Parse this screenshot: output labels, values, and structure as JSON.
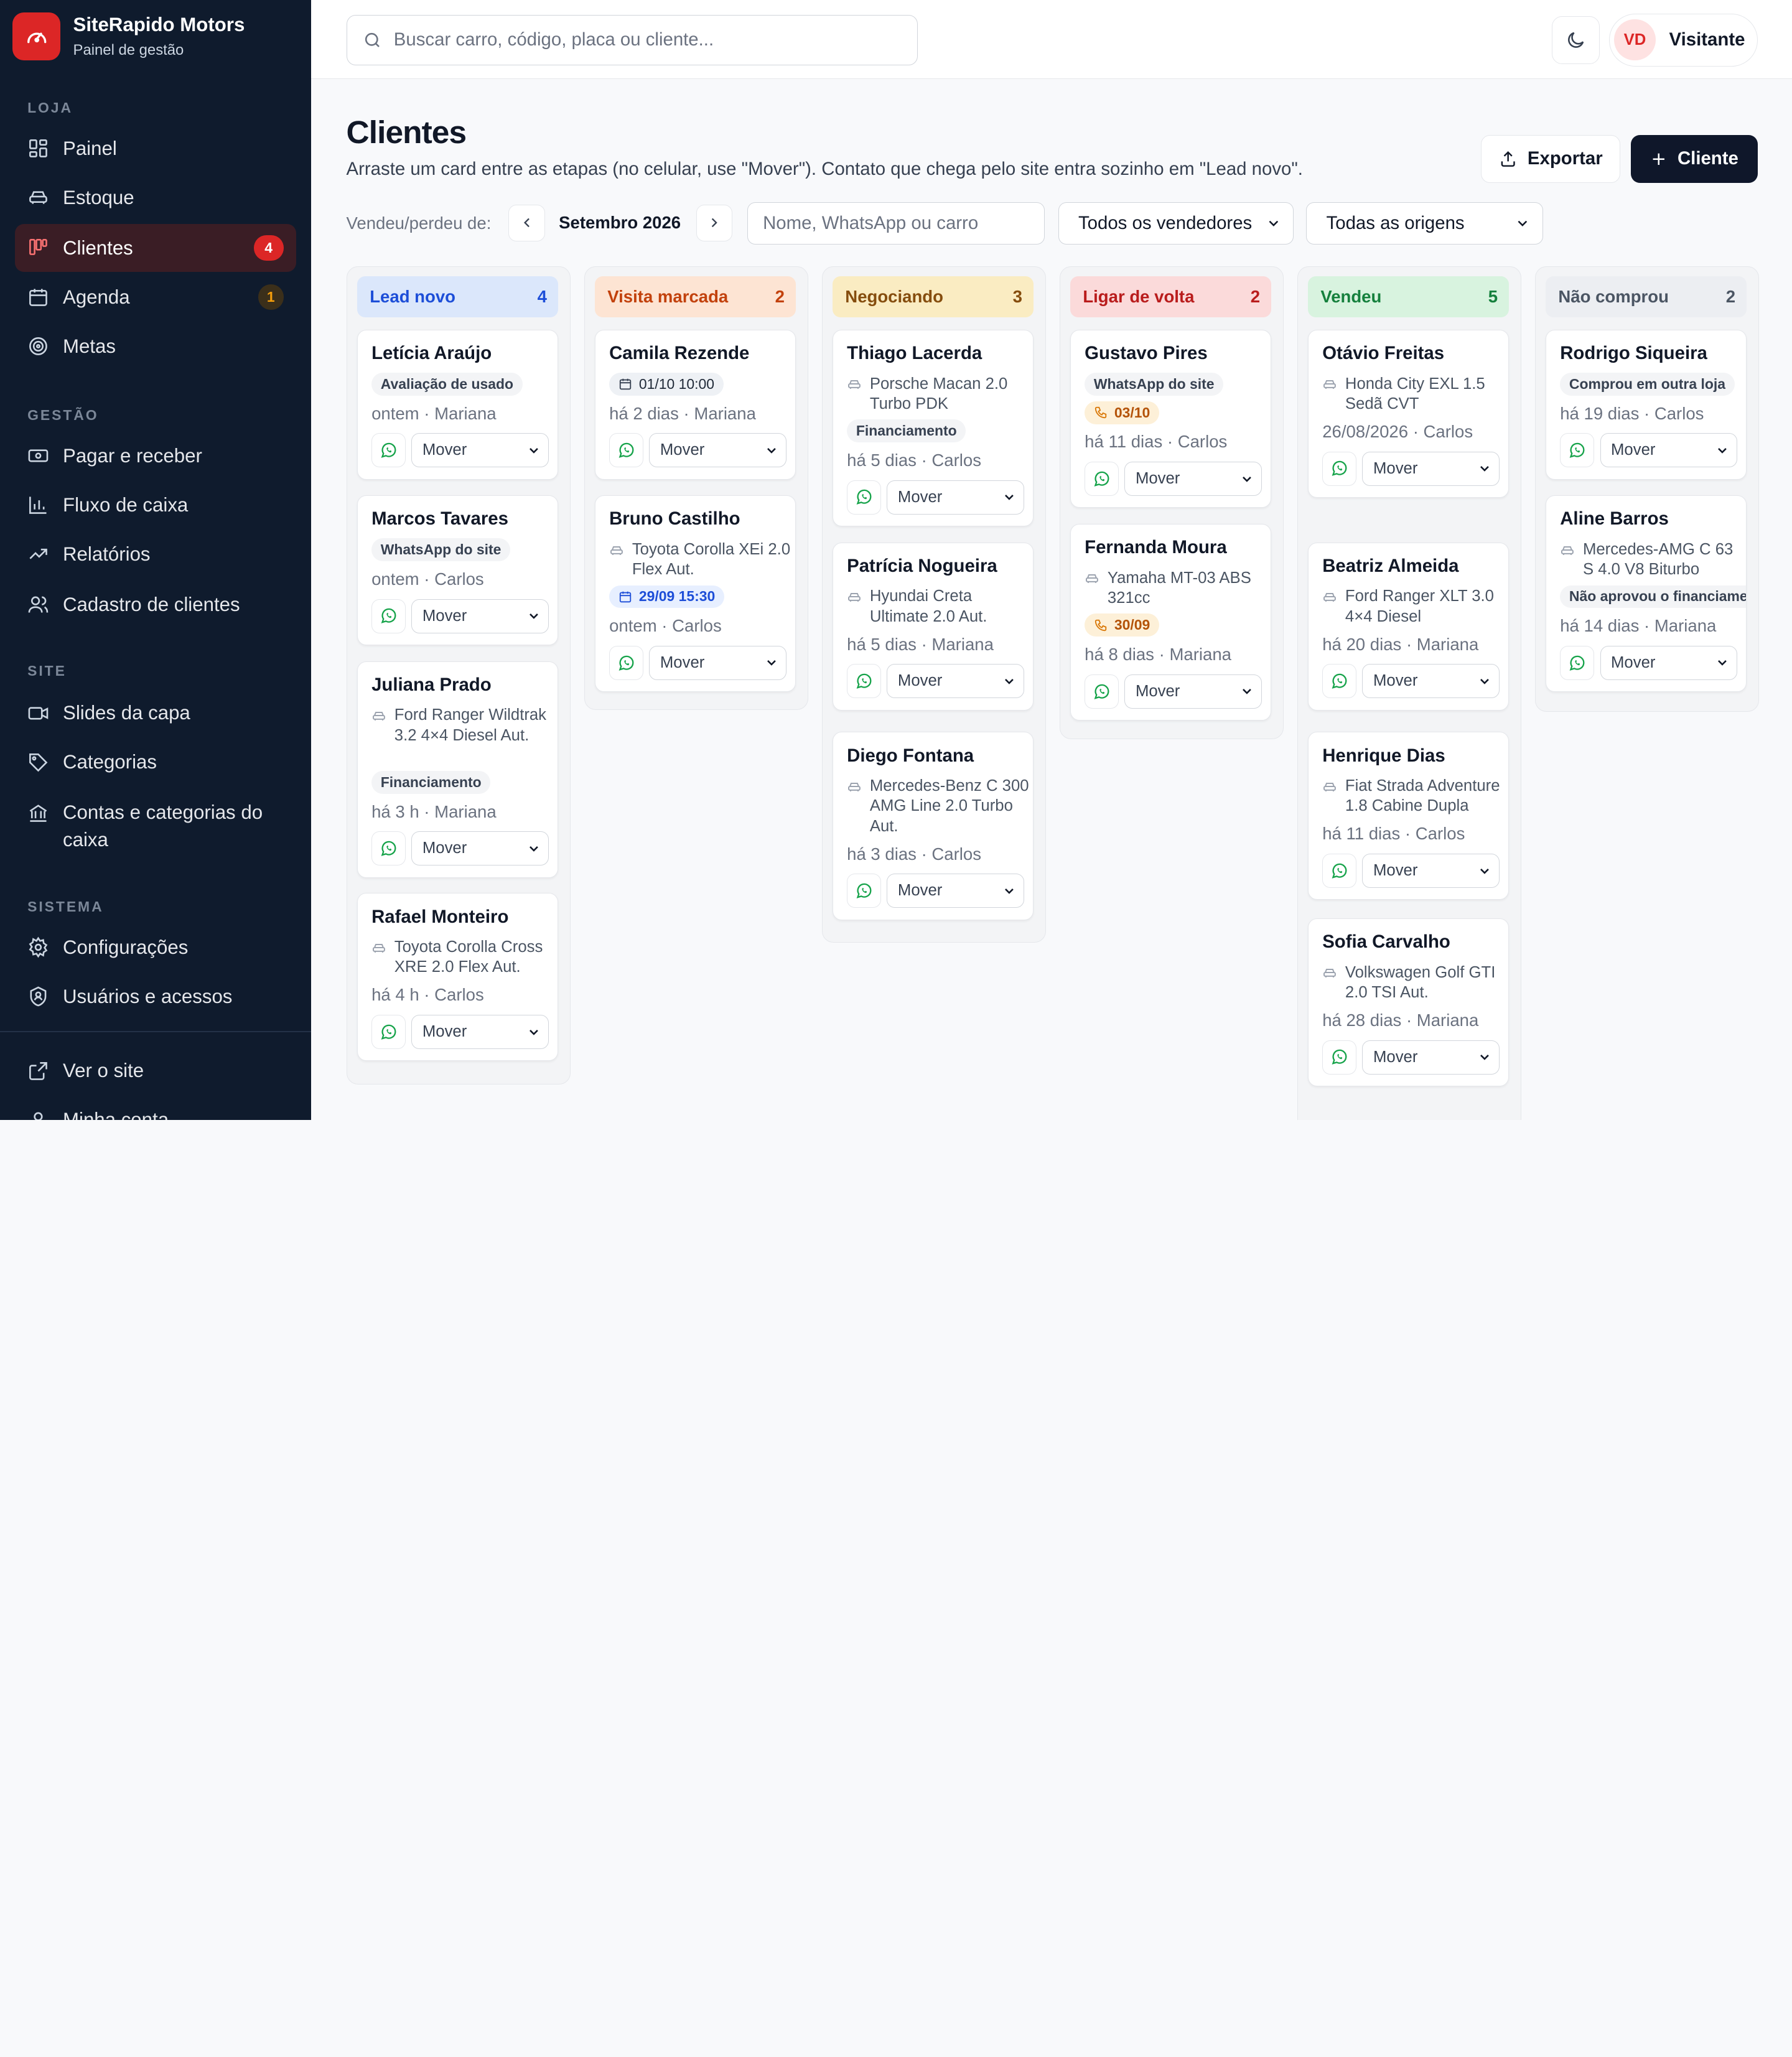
{
  "brand": {
    "name": "SiteRapido Motors",
    "subtitle": "Painel de gestão"
  },
  "sidebar": {
    "sections": {
      "loja": "LOJA",
      "gestao": "GESTÃO",
      "site": "SITE",
      "sistema": "SISTEMA"
    },
    "items": {
      "painel": "Painel",
      "estoque": "Estoque",
      "clientes": {
        "label": "Clientes",
        "badge": "4"
      },
      "agenda": {
        "label": "Agenda",
        "badge": "1"
      },
      "metas": "Metas",
      "pagar": "Pagar e receber",
      "fluxo": "Fluxo de caixa",
      "relatorios": "Relatórios",
      "cadastro": "Cadastro de clientes",
      "slides": "Slides da capa",
      "categorias": "Categorias",
      "contas": "Contas e categorias do caixa",
      "config": "Configurações",
      "usuarios": "Usuários e acessos",
      "ver_site": "Ver o site",
      "minha_conta": "Minha conta"
    }
  },
  "topbar": {
    "search_placeholder": "Buscar carro, código, placa ou cliente...",
    "user": {
      "initials": "VD",
      "name": "Visitante"
    }
  },
  "page": {
    "title": "Clientes",
    "subtitle": "Arraste um card entre as etapas (no celular, use \"Mover\"). Contato que chega pelo site entra sozinho em \"Lead novo\".",
    "export_label": "Exportar",
    "add_label": "Cliente"
  },
  "filters": {
    "label": "Vendeu/perdeu de:",
    "month": "Setembro 2026",
    "search_placeholder": "Nome, WhatsApp ou carro",
    "seller": "Todos os vendedores",
    "origin": "Todas as origens"
  },
  "mover_label": "Mover",
  "columns": [
    {
      "title": "Lead novo",
      "count": "4",
      "bg": "#dbe7fb",
      "fg": "#1d4ed8",
      "cards": [
        {
          "name": "Letícia Araújo",
          "tag": "Avaliação de usado",
          "meta": "ontem · Mariana"
        },
        {
          "name": "Marcos Tavares",
          "tag": "WhatsApp do site",
          "meta": "ontem · Carlos"
        },
        {
          "name": "Juliana Prado",
          "car": "Ford Ranger Wildtrak 3.2 4×4 Diesel Aut.",
          "tag": "Financiamento",
          "meta": "há 3 h · Mariana"
        },
        {
          "name": "Rafael Monteiro",
          "car": "Toyota Corolla Cross XRE 2.0 Flex Aut.",
          "meta": "há 4 h · Carlos"
        }
      ]
    },
    {
      "title": "Visita marcada",
      "count": "2",
      "bg": "#fde4d3",
      "fg": "#c2410c",
      "cards": [
        {
          "name": "Camila Rezende",
          "date": "01/10 10:00",
          "meta": "há 2 dias · Mariana"
        },
        {
          "name": "Bruno Castilho",
          "car": "Toyota Corolla XEi 2.0 Flex Aut.",
          "date": "29/09 15:30",
          "meta": "ontem · Carlos"
        }
      ]
    },
    {
      "title": "Negociando",
      "count": "3",
      "bg": "#faecc2",
      "fg": "#854d0e",
      "cards": [
        {
          "name": "Thiago Lacerda",
          "car": "Porsche Macan 2.0 Turbo PDK",
          "tag": "Financiamento",
          "meta": "há 5 dias · Carlos"
        },
        {
          "name": "Patrícia Nogueira",
          "car": "Hyundai Creta Ultimate 2.0 Aut.",
          "meta": "há 5 dias · Mariana"
        },
        {
          "name": "Diego Fontana",
          "car": "Mercedes-Benz C 300 AMG Line 2.0 Turbo Aut.",
          "meta": "há 3 dias · Carlos"
        }
      ]
    },
    {
      "title": "Ligar de volta",
      "count": "2",
      "bg": "#fbdada",
      "fg": "#b91c1c",
      "cards": [
        {
          "name": "Gustavo Pires",
          "tag": "WhatsApp do site",
          "phone": "03/10",
          "meta": "há 11 dias · Carlos"
        },
        {
          "name": "Fernanda Moura",
          "car": "Yamaha MT-03 ABS 321cc",
          "phone": "30/09",
          "meta": "há 8 dias · Mariana"
        }
      ]
    },
    {
      "title": "Vendeu",
      "count": "5",
      "bg": "#d8f3df",
      "fg": "#15803d",
      "cards": [
        {
          "name": "Otávio Freitas",
          "car": "Honda City EXL 1.5 Sedã CVT",
          "meta": "26/08/2026 · Carlos"
        },
        {
          "name": "Beatriz Almeida",
          "car": "Ford Ranger XLT 3.0 4×4 Diesel",
          "meta": "há 20 dias · Mariana"
        },
        {
          "name": "Henrique Dias",
          "car": "Fiat Strada Adventure 1.8 Cabine Dupla",
          "meta": "há 11 dias · Carlos"
        },
        {
          "name": "Sofia Carvalho",
          "car": "Volkswagen Golf GTI 2.0 TSI Aut.",
          "meta": "há 28 dias · Mariana"
        }
      ]
    },
    {
      "title": "Não comprou",
      "count": "2",
      "bg": "#eceef2",
      "fg": "#4b5563",
      "cards": [
        {
          "name": "Rodrigo Siqueira",
          "tag": "Comprou em outra loja",
          "meta": "há 19 dias · Carlos"
        },
        {
          "name": "Aline Barros",
          "car": "Mercedes-AMG C 63 S 4.0 V8 Biturbo",
          "tag": "Não aprovou o financiamento",
          "meta": "há 14 dias · Mariana"
        }
      ]
    }
  ]
}
